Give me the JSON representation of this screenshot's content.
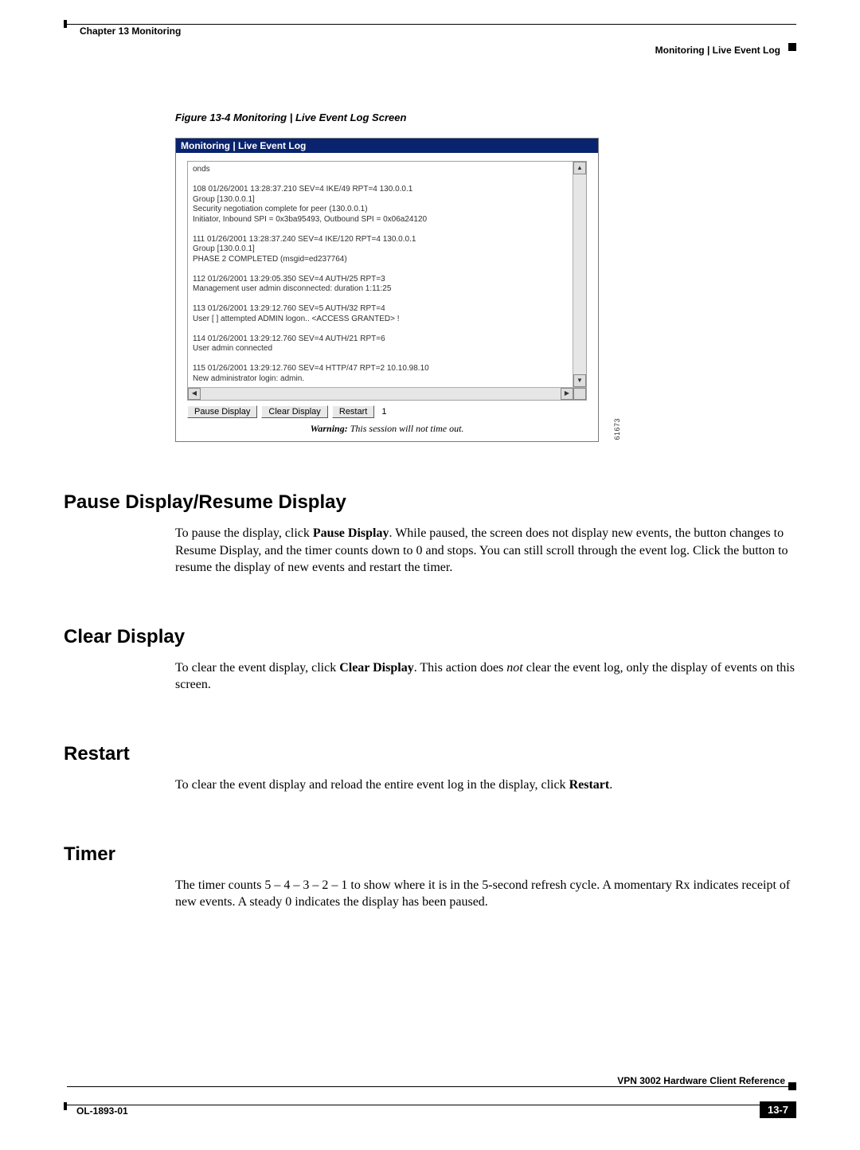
{
  "header": {
    "chapter": "Chapter 13    Monitoring",
    "breadcrumb": "Monitoring | Live Event Log"
  },
  "figure": {
    "caption": "Figure 13-4   Monitoring | Live Event Log Screen",
    "titlebar": "Monitoring | Live Event Log",
    "log_text": "onds\n\n108 01/26/2001 13:28:37.210 SEV=4 IKE/49 RPT=4 130.0.0.1\nGroup [130.0.0.1]\nSecurity negotiation complete for peer (130.0.0.1)\nInitiator, Inbound SPI = 0x3ba95493, Outbound SPI = 0x06a24120\n\n111 01/26/2001 13:28:37.240 SEV=4 IKE/120 RPT=4 130.0.0.1\nGroup [130.0.0.1]\nPHASE 2 COMPLETED (msgid=ed237764)\n\n112 01/26/2001 13:29:05.350 SEV=4 AUTH/25 RPT=3\nManagement user admin disconnected: duration 1:11:25\n\n113 01/26/2001 13:29:12.760 SEV=5 AUTH/32 RPT=4\nUser [  ] attempted ADMIN logon.. <ACCESS GRANTED> !\n\n114 01/26/2001 13:29:12.760 SEV=4 AUTH/21 RPT=6\nUser admin connected\n\n115 01/26/2001 13:29:12.760 SEV=4 HTTP/47 RPT=2 10.10.98.10\nNew administrator login: admin.",
    "buttons": {
      "pause": "Pause Display",
      "clear": "Clear Display",
      "restart": "Restart"
    },
    "timer_value": "1",
    "warning_bold": "Warning:",
    "warning_rest": " This session will not time out.",
    "figure_id": "61673"
  },
  "sections": {
    "s1": {
      "title": "Pause Display/Resume Display",
      "p1a": "To pause the display, click ",
      "p1b": "Pause Display",
      "p1c": ". While paused, the screen does not display new events, the button changes to Resume Display, and the timer counts down to 0 and stops. You can still scroll through the event log. Click the button to resume the display of new events and restart the timer."
    },
    "s2": {
      "title": "Clear Display",
      "p1a": "To clear the event display, click ",
      "p1b": "Clear Display",
      "p1c": ". This action does ",
      "p1d": "not",
      "p1e": " clear the event log, only the display of events on this screen."
    },
    "s3": {
      "title": "Restart",
      "p1a": "To clear the event display and reload the entire event log in the display, click ",
      "p1b": "Restart",
      "p1c": "."
    },
    "s4": {
      "title": "Timer",
      "p1": "The timer counts 5 – 4 – 3 – 2 – 1 to show where it is in the 5-second refresh cycle. A momentary Rx indicates receipt of new events. A steady 0 indicates the display has been paused."
    }
  },
  "footer": {
    "doc_title": "VPN 3002 Hardware Client Reference",
    "doc_id": "OL-1893-01",
    "page": "13-7"
  }
}
